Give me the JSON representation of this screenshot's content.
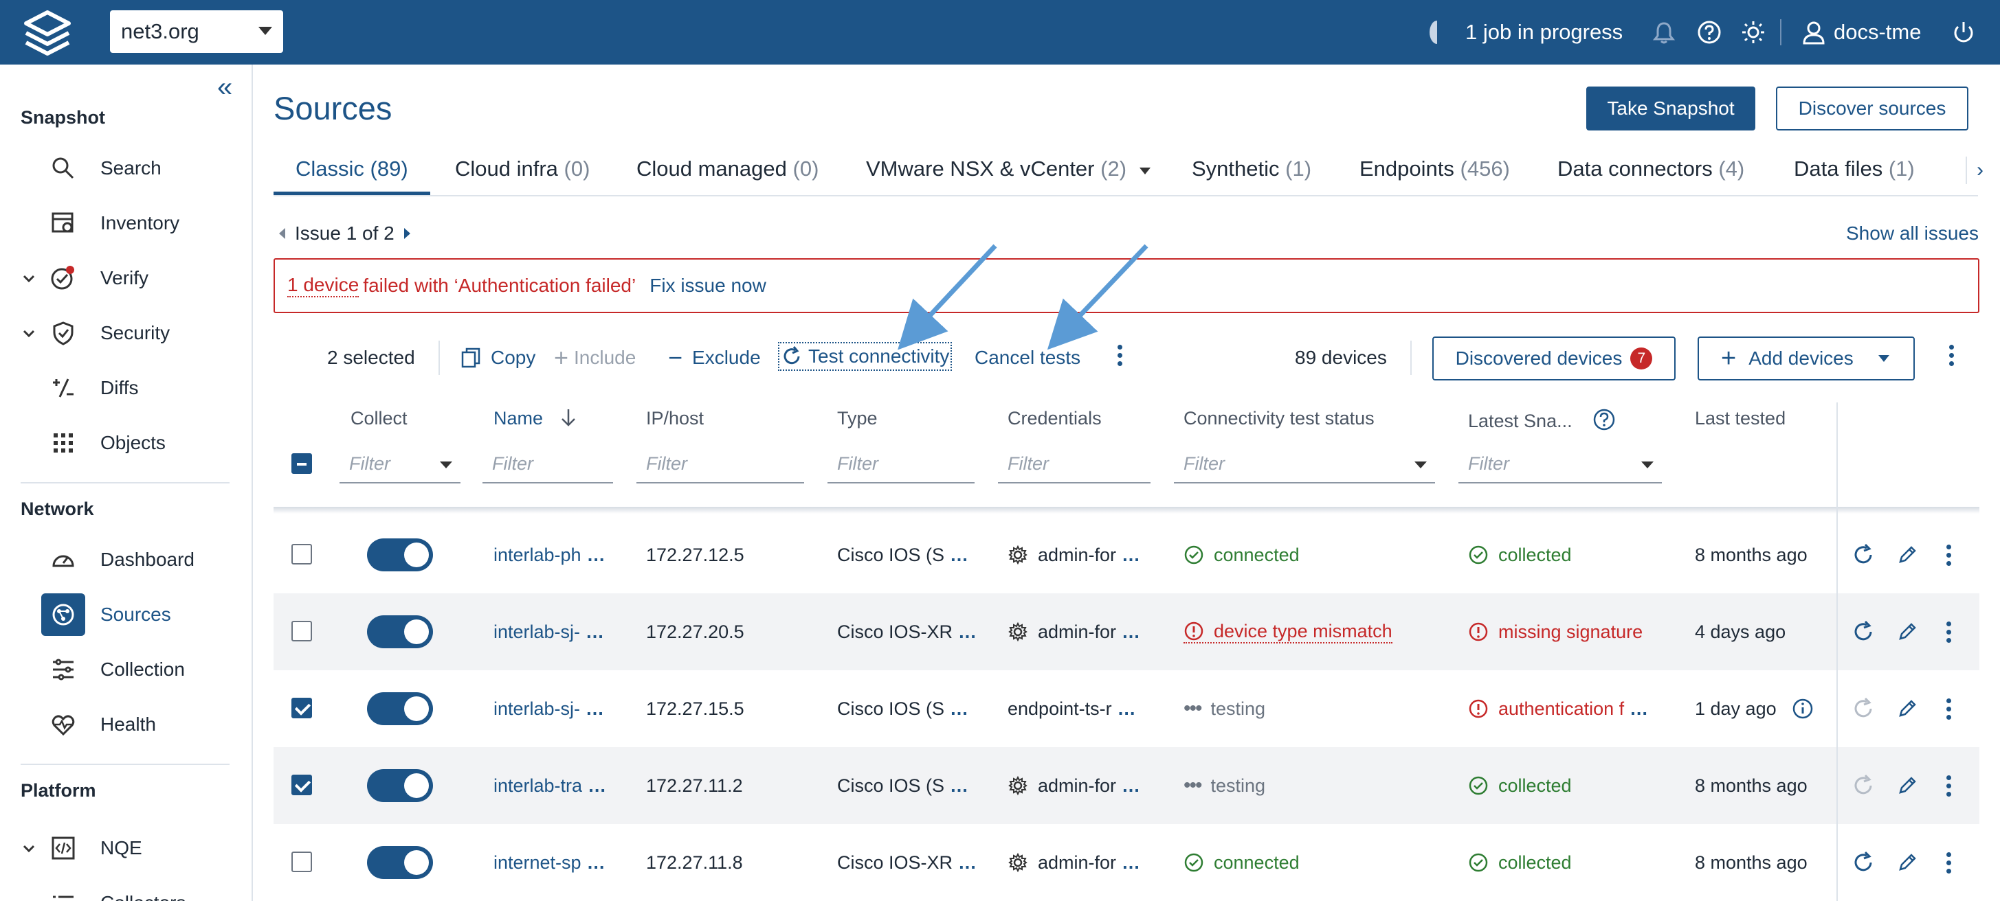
{
  "topbar": {
    "org": "net3.org",
    "job_status": "1 job in progress",
    "user": "docs-tme"
  },
  "sidebar": {
    "sections": [
      {
        "title": "Snapshot",
        "items": [
          {
            "label": "Search",
            "icon": "search-icon"
          },
          {
            "label": "Inventory",
            "icon": "inventory-icon"
          },
          {
            "label": "Verify",
            "icon": "verify-icon"
          },
          {
            "label": "Security",
            "icon": "shield-icon"
          },
          {
            "label": "Diffs",
            "icon": "diffs-icon"
          },
          {
            "label": "Objects",
            "icon": "grid-icon"
          }
        ]
      },
      {
        "title": "Network",
        "items": [
          {
            "label": "Dashboard",
            "icon": "gauge-icon"
          },
          {
            "label": "Sources",
            "icon": "sources-icon"
          },
          {
            "label": "Collection",
            "icon": "sliders-icon"
          },
          {
            "label": "Health",
            "icon": "heart-icon"
          }
        ]
      },
      {
        "title": "Platform",
        "items": [
          {
            "label": "NQE",
            "icon": "code-icon"
          },
          {
            "label": "Collectors",
            "icon": "list-icon"
          }
        ]
      }
    ]
  },
  "page": {
    "title": "Sources",
    "take_snapshot": "Take Snapshot",
    "discover_sources": "Discover sources"
  },
  "tabs": [
    {
      "label": "Classic",
      "count": "(89)"
    },
    {
      "label": "Cloud infra",
      "count": "(0)"
    },
    {
      "label": "Cloud managed",
      "count": "(0)"
    },
    {
      "label": "VMware NSX & vCenter",
      "count": "(2)"
    },
    {
      "label": "Synthetic",
      "count": "(1)"
    },
    {
      "label": "Endpoints",
      "count": "(456)"
    },
    {
      "label": "Data connectors",
      "count": "(4)"
    },
    {
      "label": "Data files",
      "count": "(1)"
    }
  ],
  "issues": {
    "nav": "Issue 1 of 2",
    "show_all": "Show all issues",
    "device_link": "1 device",
    "message": "failed with ‘Authentication failed’",
    "fix": "Fix issue now"
  },
  "toolbar": {
    "selected": "2 selected",
    "copy": "Copy",
    "include": "Include",
    "exclude": "Exclude",
    "test": "Test connectivity",
    "cancel": "Cancel tests",
    "device_count": "89 devices",
    "discovered": "Discovered devices",
    "discovered_badge": "7",
    "add": "Add devices"
  },
  "columns": {
    "collect": "Collect",
    "name": "Name",
    "ip": "IP/host",
    "type": "Type",
    "credentials": "Credentials",
    "conn_status": "Connectivity test status",
    "latest": "Latest Sna...",
    "last_tested": "Last tested",
    "filter_placeholder": "Filter"
  },
  "rows": [
    {
      "checked": false,
      "name": "interlab-ph",
      "ip": "172.27.12.5",
      "type": "Cisco IOS (S",
      "cred": "admin-for",
      "cred_icon": true,
      "conn": "connected",
      "conn_state": "ok",
      "snap": "collected",
      "snap_state": "ok",
      "tested": "8 months ago",
      "active": true
    },
    {
      "checked": false,
      "name": "interlab-sj-",
      "ip": "172.27.20.5",
      "type": "Cisco IOS-XR",
      "cred": "admin-for",
      "cred_icon": true,
      "conn": "device type mismatch",
      "conn_state": "err",
      "snap": "missing signature",
      "snap_state": "err",
      "tested": "4 days ago",
      "active": true
    },
    {
      "checked": true,
      "name": "interlab-sj-",
      "ip": "172.27.15.5",
      "type": "Cisco IOS (S",
      "cred": "endpoint-ts-r",
      "cred_icon": false,
      "conn": "testing",
      "conn_state": "test",
      "snap": "authentication f",
      "snap_state": "err",
      "tested": "1 day ago",
      "active": false
    },
    {
      "checked": true,
      "name": "interlab-tra",
      "ip": "172.27.11.2",
      "type": "Cisco IOS (S",
      "cred": "admin-for",
      "cred_icon": true,
      "conn": "testing",
      "conn_state": "test",
      "snap": "collected",
      "snap_state": "ok",
      "tested": "8 months ago",
      "active": false
    },
    {
      "checked": false,
      "name": "internet-sp",
      "ip": "172.27.11.8",
      "type": "Cisco IOS-XR",
      "cred": "admin-for",
      "cred_icon": true,
      "conn": "connected",
      "conn_state": "ok",
      "snap": "collected",
      "snap_state": "ok",
      "tested": "8 months ago",
      "active": true
    }
  ],
  "colors": {
    "brand": "#1d5487",
    "error": "#c62828",
    "success": "#2e7d32",
    "annotation": "#5b9bd5"
  }
}
